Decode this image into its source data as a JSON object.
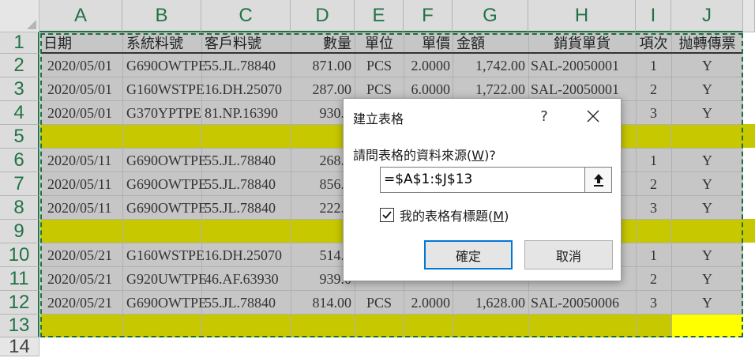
{
  "columns": [
    "A",
    "B",
    "C",
    "D",
    "E",
    "F",
    "G",
    "H",
    "I",
    "J"
  ],
  "rows": [
    "1",
    "2",
    "3",
    "4",
    "5",
    "6",
    "7",
    "8",
    "9",
    "10",
    "11",
    "12",
    "13",
    "14"
  ],
  "headers": [
    "日期",
    "系統料號",
    "客戶料號",
    "數量",
    "單位",
    "單價",
    "金額",
    "銷貨單貨",
    "項次",
    "抛轉傳票"
  ],
  "data_rows": [
    [
      "2020/05/01",
      "G690OWTPE",
      "55.JL.78840",
      "871.00",
      "PCS",
      "2.0000",
      "1,742.00",
      "SAL-20050001",
      "1",
      "Y"
    ],
    [
      "2020/05/01",
      "G160WSTPE",
      "16.DH.25070",
      "287.00",
      "PCS",
      "6.0000",
      "1,722.00",
      "SAL-20050001",
      "2",
      "Y"
    ],
    [
      "2020/05/01",
      "G370YPTPE",
      "81.NP.16390",
      "930.0",
      "",
      "",
      "",
      "",
      "3",
      "Y"
    ],
    [
      "2020/05/11",
      "G690OWTPE",
      "55.JL.78840",
      "268.0",
      "",
      "",
      "",
      "",
      "1",
      "Y"
    ],
    [
      "2020/05/11",
      "G690OWTPE",
      "55.JL.78840",
      "856.0",
      "",
      "",
      "",
      "",
      "2",
      "Y"
    ],
    [
      "2020/05/11",
      "G690OWTPE",
      "55.JL.78840",
      "222.0",
      "",
      "",
      "",
      "",
      "3",
      "Y"
    ],
    [
      "2020/05/21",
      "G160WSTPE",
      "16.DH.25070",
      "514.0",
      "",
      "",
      "",
      "",
      "1",
      "Y"
    ],
    [
      "2020/05/21",
      "G920UWTPE",
      "46.AF.63930",
      "939.0",
      "",
      "",
      "",
      "",
      "2",
      "Y"
    ],
    [
      "2020/05/21",
      "G690OWTPE",
      "55.JL.78840",
      "814.00",
      "PCS",
      "2.0000",
      "1,628.00",
      "SAL-20050006",
      "3",
      "Y"
    ]
  ],
  "colors": {
    "selection_fill": "#c6c6c6",
    "yellow_row": "#c8c800",
    "bright_yellow": "#ffff00",
    "excel_green": "#217346",
    "ok_border": "#0078d7"
  },
  "dialog": {
    "title": "建立表格",
    "help": "?",
    "close_icon": "close-icon",
    "prompt_text": "請問表格的資料來源(",
    "prompt_key": "W",
    "prompt_end": ")?",
    "range_value": "=$A$1:$J$13",
    "collapse_icon": "collapse-dialog-icon",
    "checkbox_checked": true,
    "checkbox_text": "我的表格有標題(",
    "checkbox_key": "M",
    "checkbox_end": ")",
    "ok_label": "確定",
    "cancel_label": "取消"
  }
}
